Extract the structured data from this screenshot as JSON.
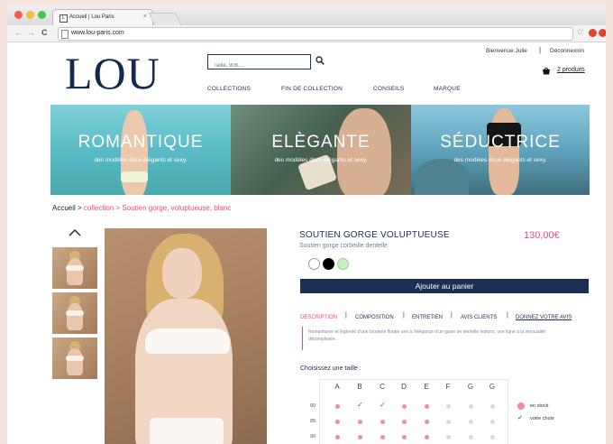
{
  "browser": {
    "tab_title": "Accueil | Lou Paris",
    "tab_favicon": "L",
    "url": "www.lou-paris.com"
  },
  "site": {
    "logo": "LOU",
    "search_placeholder": "Taille, 90b,...",
    "welcome": "Bienvenue Julie",
    "separator": "|",
    "logout": "Déconnexion",
    "cart": "2 produits",
    "nav": [
      "COLLECTIONS",
      "FIN DE COLLECTION",
      "CONSEILS",
      "MARQUE"
    ]
  },
  "banner": [
    {
      "title": "ROMANTIQUE",
      "subtitle": "des modèles doux élégants et sexy."
    },
    {
      "title": "ELÈGANTE",
      "subtitle": "des modèles doux élégants et sexy."
    },
    {
      "title": "SÉDUCTRICE",
      "subtitle": "des modèles doux élégants et sexy."
    }
  ],
  "breadcrumb": {
    "home": "Accueil",
    "sep1": " > ",
    "collection": "collection",
    "sep2": " > ",
    "product": "Soutien gorge, voluptueuse, blanc"
  },
  "product": {
    "name": "SOUTIEN GORGE VOLUPTUEUSE",
    "price": "130,00€",
    "subtitle": "Soutien gorge corbeille dentelle",
    "swatches": [
      "#ffffff",
      "#000000",
      "#c9f0c2"
    ],
    "add_to_cart": "Ajouter au panier",
    "tabs": [
      "DESCRIPTION",
      "COMPOSITION",
      "ENTRETIEN",
      "AVIS CLIENTS",
      "DONNEZ VOTRE AVIS"
    ],
    "description": "Romantisme et légèreté d'une broderie florale une à l'élégance d'un galon de dentelle festons, une ligne à la sensualité décomplexée.",
    "choose_size": "Choisissez une taille :"
  },
  "size_grid": {
    "columns": [
      "A",
      "B",
      "C",
      "D",
      "E",
      "F",
      "G",
      "G"
    ],
    "rows": [
      "80",
      "85",
      "90"
    ],
    "legend": {
      "in_stock": "en stock",
      "your_choice": "votre choix"
    }
  },
  "colors": {
    "navy": "#1b2e53",
    "pink": "#e74c7a",
    "stock_dot": "#f08ca8"
  }
}
